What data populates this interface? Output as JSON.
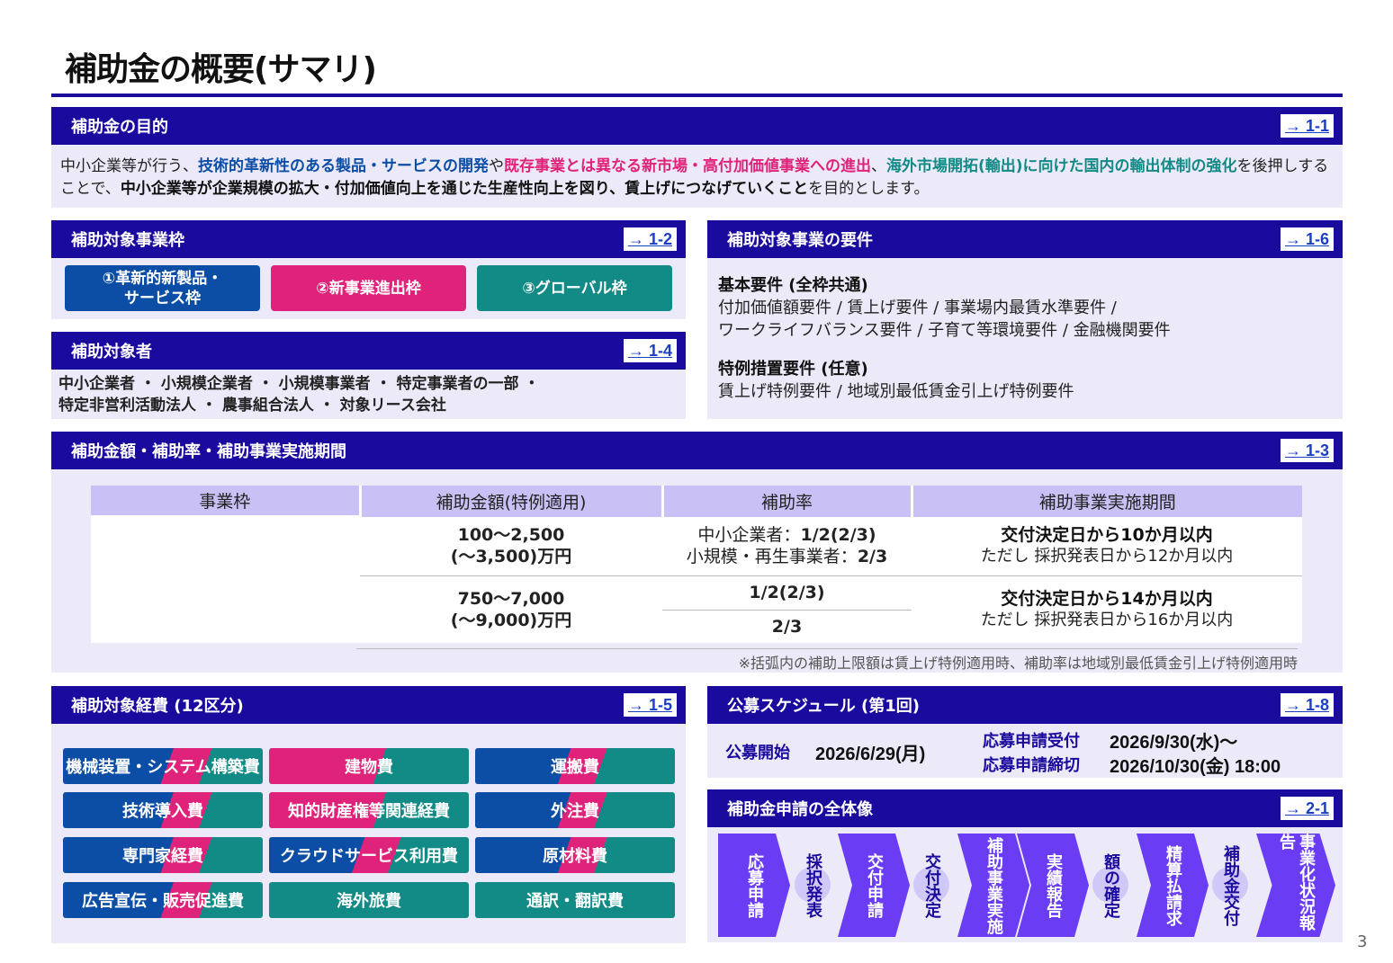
{
  "title": "補助金の概要(サマリ)",
  "purpose": {
    "header": "補助金の目的",
    "ref": "→ 1-1",
    "t1": "中小企業等が行う、",
    "t2": "技術的革新性のある製品・サービスの開発",
    "t3": "や",
    "t4": "既存事業とは異なる新市場・高付加価値事業への進出",
    "t5": "、",
    "t6": "海外市場開拓(輸出)に向けた国内の輸出体制の強化",
    "t7": "を後押しすることで、",
    "t8": "中小企業等が企業規模の拡大・付加価値向上を通じた生産性向上を図り、賃上げにつなげていくこと",
    "t9": "を目的とします。"
  },
  "frames": {
    "header": "補助対象事業枠",
    "ref": "→ 1-2",
    "items": [
      "①革新的新製品・サービス枠",
      "②新事業進出枠",
      "③グローバル枠"
    ],
    "item1_line1": "①革新的新製品・",
    "item1_line2": "サービス枠"
  },
  "targets": {
    "header": "補助対象者",
    "ref": "→ 1-4",
    "line1": "中小企業者 ・ 小規模企業者 ・ 小規模事業者 ・ 特定事業者の一部 ・",
    "line2": "特定非営利活動法人 ・ 農事組合法人 ・ 対象リース会社"
  },
  "requirements": {
    "header": "補助対象事業の要件",
    "ref": "→ 1-6",
    "basic_title": "基本要件 (全枠共通)",
    "basic_line1": "付加価値額要件 / 賃上げ要件 / 事業場内最賃水準要件 /",
    "basic_line2": "ワークライフバランス要件 / 子育て等環境要件 / 金融機関要件",
    "special_title": "特例措置要件 (任意)",
    "special_line1": "賃上げ特例要件 / 地域別最低賃金引上げ特例要件"
  },
  "amount": {
    "header": "補助金額・補助率・補助事業実施期間",
    "ref": "→ 1-3",
    "columns": [
      "事業枠",
      "補助金額(特例適用)",
      "補助率",
      "補助事業実施期間"
    ],
    "row1": {
      "frame": "①革新的新製品・サービス枠",
      "amount1": "100～2,500",
      "amount2": "(～3,500)万円",
      "rate1_label": "中小企業者：",
      "rate1_value": "1/2(2/3)",
      "rate2_label": "小規模・再生事業者：",
      "rate2_value": "2/3",
      "period1": "交付決定日から10か月以内",
      "period2": "ただし 採択発表日から12か月以内"
    },
    "row2": {
      "frame_a": "②新事業進出枠",
      "frame_b": "③グローバル枠",
      "amount1": "750～7,000",
      "amount2": "(～9,000)万円",
      "rate_a": "1/2(2/3)",
      "rate_b": "2/3",
      "period1": "交付決定日から14か月以内",
      "period2": "ただし 採択発表日から16か月以内"
    },
    "note": "※括弧内の補助上限額は賃上げ特例適用時、補助率は地域別最低賃金引上げ特例適用時"
  },
  "costs": {
    "header": "補助対象経費 (12区分)",
    "ref": "→ 1-5",
    "items": [
      "機械装置・システム構築費",
      "建物費",
      "運搬費",
      "技術導入費",
      "知的財産権等関連経費",
      "外注費",
      "専門家経費",
      "クラウドサービス利用費",
      "原材料費",
      "広告宣伝・販売促進費",
      "海外旅費",
      "通訳・翻訳費"
    ]
  },
  "schedule": {
    "header": "公募スケジュール (第1回)",
    "ref": "→ 1-8",
    "start_label": "公募開始",
    "start_date": "2026/6/29(月)",
    "accept_label": "応募申請受付",
    "accept_date": "2026/9/30(水)～",
    "close_label": "応募申請締切",
    "close_date": "2026/10/30(金) 18:00"
  },
  "flow": {
    "header": "補助金申請の全体像",
    "ref": "→ 2-1",
    "steps": [
      "応募申請",
      "採択発表",
      "交付申請",
      "交付決定",
      "補助事業実施",
      "実績報告",
      "額の確定",
      "精算払請求",
      "補助金交付",
      "事業化状況報告"
    ]
  },
  "page_number": "3",
  "colors": {
    "navy": "#1a0a9e",
    "blue": "#0c4ea6",
    "pink": "#e0237a",
    "teal": "#128a86",
    "violet": "#6a3df5"
  }
}
